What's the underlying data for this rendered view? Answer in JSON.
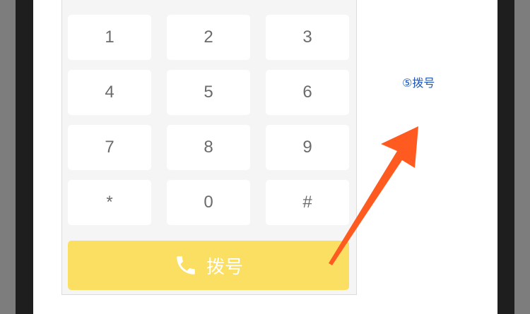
{
  "keypad": {
    "keys": [
      "1",
      "2",
      "3",
      "4",
      "5",
      "6",
      "7",
      "8",
      "9",
      "*",
      "0",
      "#"
    ]
  },
  "dial_button": {
    "label": "拨号",
    "icon": "phone-icon",
    "color": "#fbdf62"
  },
  "annotation": {
    "label": "⑤拨号",
    "color": "#1f57b9",
    "arrow_color": "#ff5a1f"
  }
}
